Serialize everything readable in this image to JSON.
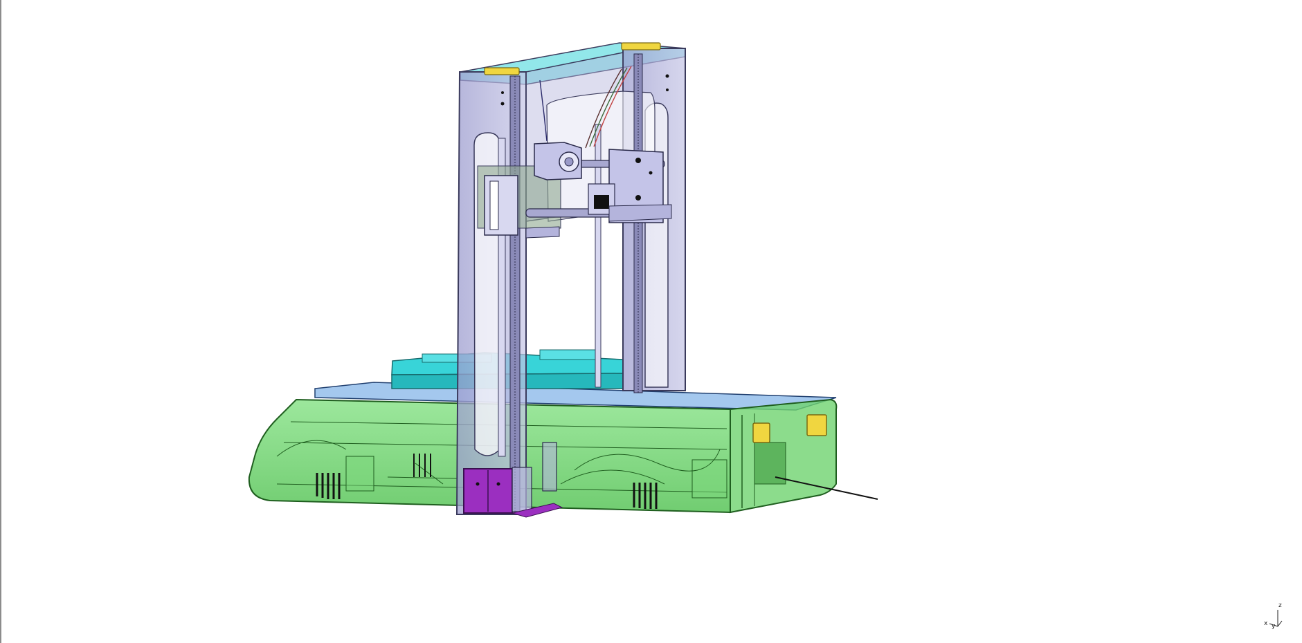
{
  "viewer": {
    "background_color": "#ffffff",
    "edge_color": "#8c8c8c"
  },
  "model": {
    "name_icon": "3d-printer-assembly",
    "colors": {
      "frame": "#b4b4dc",
      "frame_stroke": "#3a3a5c",
      "base": "#6fd36f",
      "base_stroke": "#1f5e1f",
      "bed": "#38d4d8",
      "bed_top": "#5a9ae0",
      "motor": "#9b2fc0",
      "caps": "#f0d640",
      "carriage": "#c4c4e8",
      "dark": "#111111"
    }
  },
  "compass": {
    "x_label": "x",
    "y_label": "y",
    "z_label": "z"
  }
}
